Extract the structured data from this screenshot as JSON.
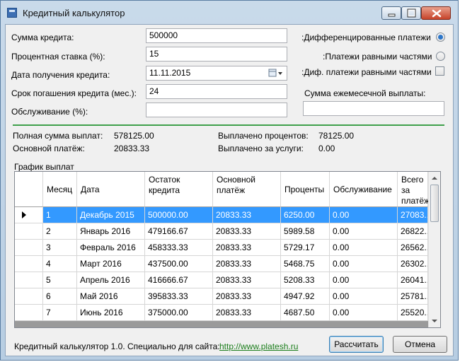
{
  "window": {
    "title": "Кредитный калькулятор"
  },
  "form": {
    "amount_label": "Сумма кредита:",
    "amount_value": "500000",
    "rate_label": "Процентная ставка (%):",
    "rate_value": "15",
    "date_label": "Дата получения кредита:",
    "date_value": "11.11.2015",
    "term_label": "Срок погашения кредита (мес.):",
    "term_value": "24",
    "service_label": "Обслуживание (%):",
    "service_value": ""
  },
  "options": {
    "diff_label": ":Дифференцированные платежи",
    "diff_selected": true,
    "equal_label": ":Платежи равными частями",
    "equal_selected": false,
    "diff_equal_label": ":Диф. платежи равными частями",
    "diff_equal_checked": false,
    "monthly_label": "Сумма ежемесечной выплаты:",
    "monthly_value": ""
  },
  "summary": {
    "total_label": "Полная сумма выплат:",
    "total_value": "578125.00",
    "principal_label": "Основной платёж:",
    "principal_value": "20833.33",
    "interest_label": "Выплачено процентов:",
    "interest_value": "78125.00",
    "services_label": "Выплачено за услуги:",
    "services_value": "0.00"
  },
  "schedule": {
    "title": "График выплат",
    "columns": {
      "month": "Месяц",
      "date": "Дата",
      "balance": "Остаток кредита",
      "principal": "Основной платёж",
      "interest": "Проценты",
      "service": "Обслуживание",
      "total": "Всего за платёж"
    },
    "rows": [
      {
        "month": "1",
        "date": "Декабрь 2015",
        "balance": "500000.00",
        "principal": "20833.33",
        "interest": "6250.00",
        "service": "0.00",
        "total": "27083...."
      },
      {
        "month": "2",
        "date": "Январь 2016",
        "balance": "479166.67",
        "principal": "20833.33",
        "interest": "5989.58",
        "service": "0.00",
        "total": "26822...."
      },
      {
        "month": "3",
        "date": "Февраль 2016",
        "balance": "458333.33",
        "principal": "20833.33",
        "interest": "5729.17",
        "service": "0.00",
        "total": "26562...."
      },
      {
        "month": "4",
        "date": "Март 2016",
        "balance": "437500.00",
        "principal": "20833.33",
        "interest": "5468.75",
        "service": "0.00",
        "total": "26302...."
      },
      {
        "month": "5",
        "date": "Апрель 2016",
        "balance": "416666.67",
        "principal": "20833.33",
        "interest": "5208.33",
        "service": "0.00",
        "total": "26041...."
      },
      {
        "month": "6",
        "date": "Май 2016",
        "balance": "395833.33",
        "principal": "20833.33",
        "interest": "4947.92",
        "service": "0.00",
        "total": "25781...."
      },
      {
        "month": "7",
        "date": "Июнь 2016",
        "balance": "375000.00",
        "principal": "20833.33",
        "interest": "4687.50",
        "service": "0.00",
        "total": "25520...."
      }
    ],
    "selected_row": 0
  },
  "footer": {
    "text": "Кредитный калькулятор 1.0. Специально для сайта:",
    "link": "http://www.platesh.ru",
    "calculate": "Рассчитать",
    "cancel": "Отмена"
  },
  "colors": {
    "accent_line": "#3fa04b",
    "selection": "#3399ff",
    "link": "#1a7d1a"
  }
}
